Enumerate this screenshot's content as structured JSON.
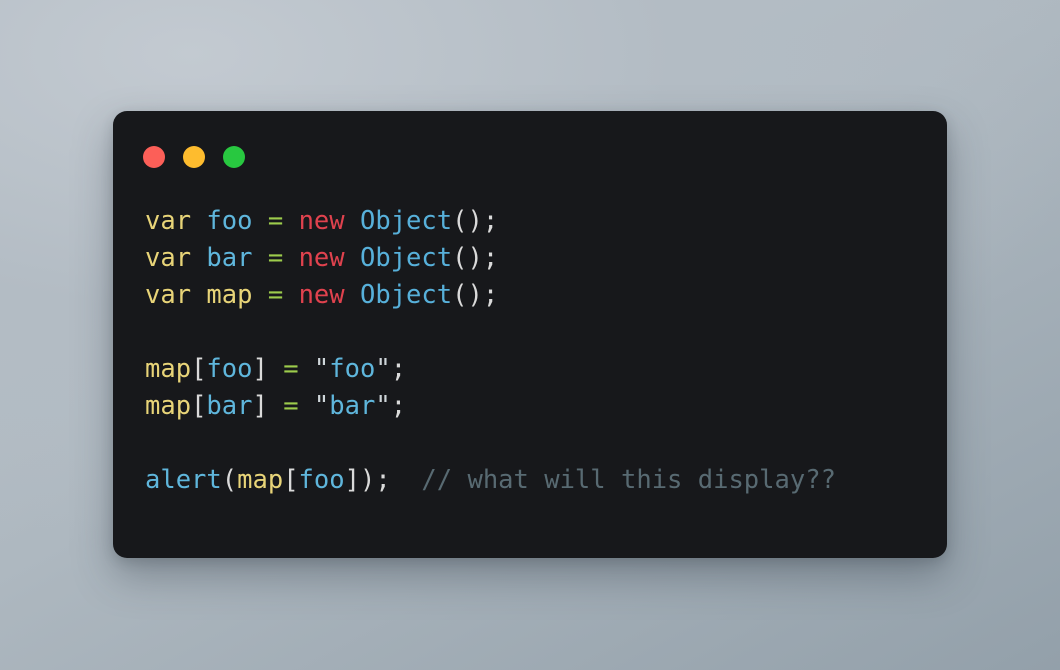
{
  "window": {
    "name": "code-snippet-window",
    "background_color": "#17181b",
    "corner_radius_px": 14,
    "traffic_lights": [
      {
        "name": "close-button",
        "label": "Close",
        "color": "#fc5f58"
      },
      {
        "name": "minimize-button",
        "label": "Minimize",
        "color": "#febc2e"
      },
      {
        "name": "maximize-button",
        "label": "Maximize",
        "color": "#28c840"
      }
    ]
  },
  "page": {
    "background_top_color": "#bdc5cc",
    "background_bottom_color": "#93a0aa"
  },
  "code": {
    "language": "javascript",
    "plain_text": "var foo = new Object();\nvar bar = new Object();\nvar map = new Object();\n\nmap[foo] = \"foo\";\nmap[bar] = \"bar\";\n\nalert(map[foo]);  // what will this display??",
    "colors": {
      "keyword": "#e8d478",
      "identifier": "#5fb6dc",
      "new_keyword": "#e0424e",
      "operator": "#9dcc4c",
      "punctuation": "#dadada",
      "string": "#5fb6dc",
      "comment": "#586a72"
    },
    "lines": [
      {
        "index": 1,
        "text": "var foo = new Object();",
        "tokens": [
          {
            "text": "var",
            "type": "keyword"
          },
          {
            "text": " ",
            "type": "punc"
          },
          {
            "text": "foo",
            "type": "ident"
          },
          {
            "text": " ",
            "type": "punc"
          },
          {
            "text": "=",
            "type": "op"
          },
          {
            "text": " ",
            "type": "punc"
          },
          {
            "text": "new",
            "type": "new"
          },
          {
            "text": " ",
            "type": "punc"
          },
          {
            "text": "Object",
            "type": "type"
          },
          {
            "text": "();",
            "type": "punc"
          }
        ]
      },
      {
        "index": 2,
        "text": "var bar = new Object();",
        "tokens": [
          {
            "text": "var",
            "type": "keyword"
          },
          {
            "text": " ",
            "type": "punc"
          },
          {
            "text": "bar",
            "type": "ident"
          },
          {
            "text": " ",
            "type": "punc"
          },
          {
            "text": "=",
            "type": "op"
          },
          {
            "text": " ",
            "type": "punc"
          },
          {
            "text": "new",
            "type": "new"
          },
          {
            "text": " ",
            "type": "punc"
          },
          {
            "text": "Object",
            "type": "type"
          },
          {
            "text": "();",
            "type": "punc"
          }
        ]
      },
      {
        "index": 3,
        "text": "var map = new Object();",
        "tokens": [
          {
            "text": "var",
            "type": "keyword"
          },
          {
            "text": " ",
            "type": "punc"
          },
          {
            "text": "map",
            "type": "keyword"
          },
          {
            "text": " ",
            "type": "punc"
          },
          {
            "text": "=",
            "type": "op"
          },
          {
            "text": " ",
            "type": "punc"
          },
          {
            "text": "new",
            "type": "new"
          },
          {
            "text": " ",
            "type": "punc"
          },
          {
            "text": "Object",
            "type": "type"
          },
          {
            "text": "();",
            "type": "punc"
          }
        ]
      },
      {
        "index": 4,
        "text": "",
        "tokens": []
      },
      {
        "index": 5,
        "text": "map[foo] = \"foo\";",
        "tokens": [
          {
            "text": "map",
            "type": "keyword"
          },
          {
            "text": "[",
            "type": "punc"
          },
          {
            "text": "foo",
            "type": "ident"
          },
          {
            "text": "]",
            "type": "punc"
          },
          {
            "text": " ",
            "type": "punc"
          },
          {
            "text": "=",
            "type": "op"
          },
          {
            "text": " ",
            "type": "punc"
          },
          {
            "text": "\"",
            "type": "quote"
          },
          {
            "text": "foo",
            "type": "string"
          },
          {
            "text": "\"",
            "type": "quote"
          },
          {
            "text": ";",
            "type": "punc"
          }
        ]
      },
      {
        "index": 6,
        "text": "map[bar] = \"bar\";",
        "tokens": [
          {
            "text": "map",
            "type": "keyword"
          },
          {
            "text": "[",
            "type": "punc"
          },
          {
            "text": "bar",
            "type": "ident"
          },
          {
            "text": "]",
            "type": "punc"
          },
          {
            "text": " ",
            "type": "punc"
          },
          {
            "text": "=",
            "type": "op"
          },
          {
            "text": " ",
            "type": "punc"
          },
          {
            "text": "\"",
            "type": "quote"
          },
          {
            "text": "bar",
            "type": "string"
          },
          {
            "text": "\"",
            "type": "quote"
          },
          {
            "text": ";",
            "type": "punc"
          }
        ]
      },
      {
        "index": 7,
        "text": "",
        "tokens": []
      },
      {
        "index": 8,
        "text": "alert(map[foo]);  // what will this display??",
        "tokens": [
          {
            "text": "alert",
            "type": "fn"
          },
          {
            "text": "(",
            "type": "punc"
          },
          {
            "text": "map",
            "type": "keyword"
          },
          {
            "text": "[",
            "type": "punc"
          },
          {
            "text": "foo",
            "type": "ident"
          },
          {
            "text": "]",
            "type": "punc"
          },
          {
            "text": ");",
            "type": "punc"
          },
          {
            "text": "  ",
            "type": "punc"
          },
          {
            "text": "// what will this display??",
            "type": "comment"
          }
        ]
      }
    ]
  }
}
